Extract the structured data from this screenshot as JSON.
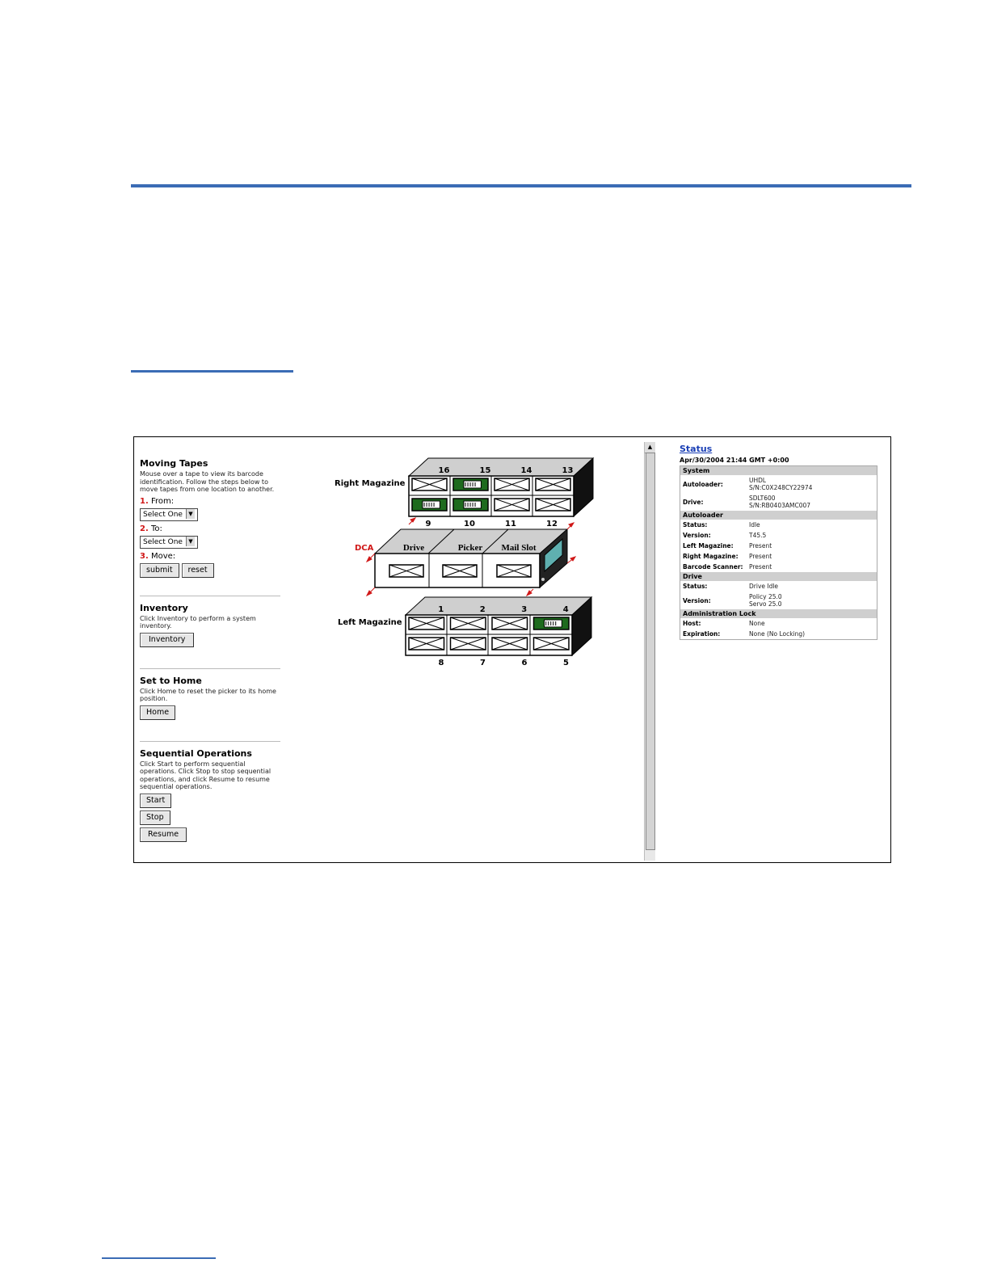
{
  "left_panel": {
    "moving": {
      "title": "Moving Tapes",
      "desc": "Mouse over a tape to view its barcode identification. Follow the steps below to move tapes from one location to another.",
      "step1_num": "1.",
      "step1_label": "From:",
      "step2_num": "2.",
      "step2_label": "To:",
      "step3_num": "3.",
      "step3_label": "Move:",
      "from_select": "Select One",
      "to_select": "Select One",
      "submit": "submit",
      "reset": "reset"
    },
    "inventory": {
      "title": "Inventory",
      "desc": "Click Inventory to perform a system inventory.",
      "button": "Inventory"
    },
    "home": {
      "title": "Set to Home",
      "desc": "Click Home to reset the picker to its home position.",
      "button": "Home"
    },
    "sequential": {
      "title": "Sequential Operations",
      "desc": "Click Start to perform sequential operations. Click Stop to stop sequential operations, and click Resume to resume sequential operations.",
      "start": "Start",
      "stop": "Stop",
      "resume": "Resume"
    }
  },
  "diagram": {
    "right_magazine": "Right Magazine",
    "left_magazine": "Left Magazine",
    "dca": "DCA",
    "drive": "Drive",
    "picker": "Picker",
    "mail_slot": "Mail Slot",
    "right_top_slots": [
      "16",
      "15",
      "14",
      "13"
    ],
    "right_bottom_slots": [
      "9",
      "10",
      "11",
      "12"
    ],
    "left_top_slots": [
      "1",
      "2",
      "3",
      "4"
    ],
    "left_bottom_slots": [
      "8",
      "7",
      "6",
      "5"
    ],
    "tapes_present": [
      "15",
      "9",
      "10",
      "4"
    ],
    "colors": {
      "tape_green": "#1e6b1e",
      "dca_red": "#d01818"
    }
  },
  "status": {
    "link": "Status",
    "date": "Apr/30/2004 21:44 GMT +0:00",
    "sections": [
      {
        "header": "System",
        "rows": [
          {
            "k": "Autoloader:",
            "v1": "UHDL",
            "v2": "S/N:C0X248CY22974"
          },
          {
            "k": "Drive:",
            "v1": "SDLT600",
            "v2": "S/N:RB0403AMC007"
          }
        ]
      },
      {
        "header": "Autoloader",
        "rows": [
          {
            "k": "Status:",
            "v1": "Idle"
          },
          {
            "k": "Version:",
            "v1": "T45.5"
          },
          {
            "k": "Left Magazine:",
            "v1": "Present"
          },
          {
            "k": "Right Magazine:",
            "v1": "Present"
          },
          {
            "k": "Barcode Scanner:",
            "v1": "Present"
          }
        ]
      },
      {
        "header": "Drive",
        "rows": [
          {
            "k": "Status:",
            "v1": "Drive Idle"
          },
          {
            "k": "Version:",
            "v1": "Policy 25.0",
            "v2": "Servo 25.0"
          }
        ]
      },
      {
        "header": "Administration Lock",
        "rows": [
          {
            "k": "Host:",
            "v1": "None"
          },
          {
            "k": "Expiration:",
            "v1": "None (No Locking)"
          }
        ]
      }
    ]
  }
}
